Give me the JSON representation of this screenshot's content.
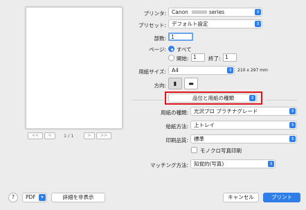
{
  "preview": {
    "page_indicator": "1 / 1",
    "first_label": "<<",
    "prev_label": "<",
    "next_label": ">",
    "last_label": ">>"
  },
  "printer": {
    "label": "プリンタ:",
    "value_prefix": "Canon",
    "value_suffix": "series"
  },
  "preset": {
    "label": "プリセット:",
    "value": "デフォルト設定"
  },
  "copies": {
    "label": "部数:",
    "value": "1"
  },
  "pages": {
    "label": "ページ:",
    "all_label": "すべて",
    "from_label": "開始:",
    "from_value": "1",
    "to_label": "終了:",
    "to_value": "1"
  },
  "paper_size": {
    "label": "用紙サイズ:",
    "value": "A4",
    "dimensions": "210 x 297 mm"
  },
  "orientation": {
    "label": "方向:"
  },
  "section": {
    "value": "品位と用紙の種類"
  },
  "media_type": {
    "label": "用紙の種類:",
    "value": "光沢プロ プラチナグレード"
  },
  "paper_source": {
    "label": "給紙方法:",
    "value": "上トレイ"
  },
  "print_quality": {
    "label": "印刷品質:",
    "value": "標準",
    "grayscale_label": "モノクロ写真印刷"
  },
  "matching": {
    "label": "マッチング方法:",
    "value": "知覚的(写真)"
  },
  "footer": {
    "help": "?",
    "pdf": "PDF",
    "details": "詳細を非表示",
    "cancel": "キャンセル",
    "print": "プリント"
  },
  "colors": {
    "accent": "#2f7ee8",
    "highlight_box": "#e0121b"
  }
}
